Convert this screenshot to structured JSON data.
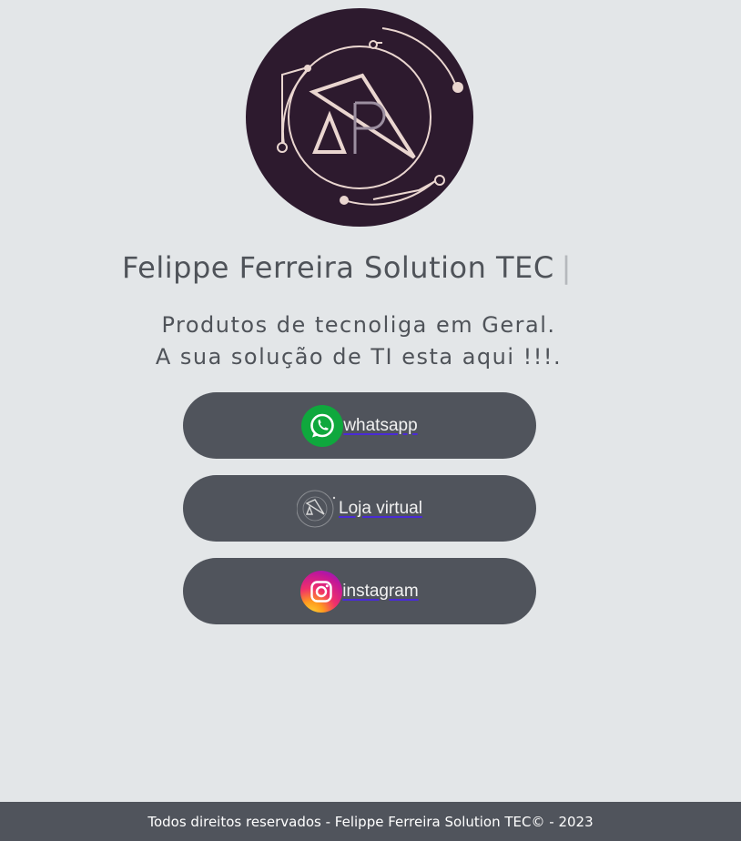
{
  "brand": {
    "logo_icon": "company-logo",
    "logo_bg": "#2d1a2e",
    "logo_fg": "#ead6d0"
  },
  "header": {
    "title": "Felippe Ferreira Solution TEC",
    "cursor": "|"
  },
  "tagline": {
    "line1": "Produtos de tecnoliga em Geral.",
    "line2": "A sua solução de TI esta aqui !!!."
  },
  "links": [
    {
      "label": "whatsapp",
      "icon": "whatsapp-icon",
      "color": "#0fa83d"
    },
    {
      "label": "Loja virtual",
      "icon": "store-logo-icon",
      "color": "#50545c"
    },
    {
      "label": "instagram",
      "icon": "instagram-icon",
      "color": "#e1306c"
    }
  ],
  "footer": {
    "text": "Todos direitos reservados - Felippe Ferreira Solution TEC© - 2023"
  },
  "colors": {
    "page_bg": "#e3e6e8",
    "button_bg": "#50545c",
    "text": "#4f5359",
    "link_underline": "#4a2bd6"
  }
}
